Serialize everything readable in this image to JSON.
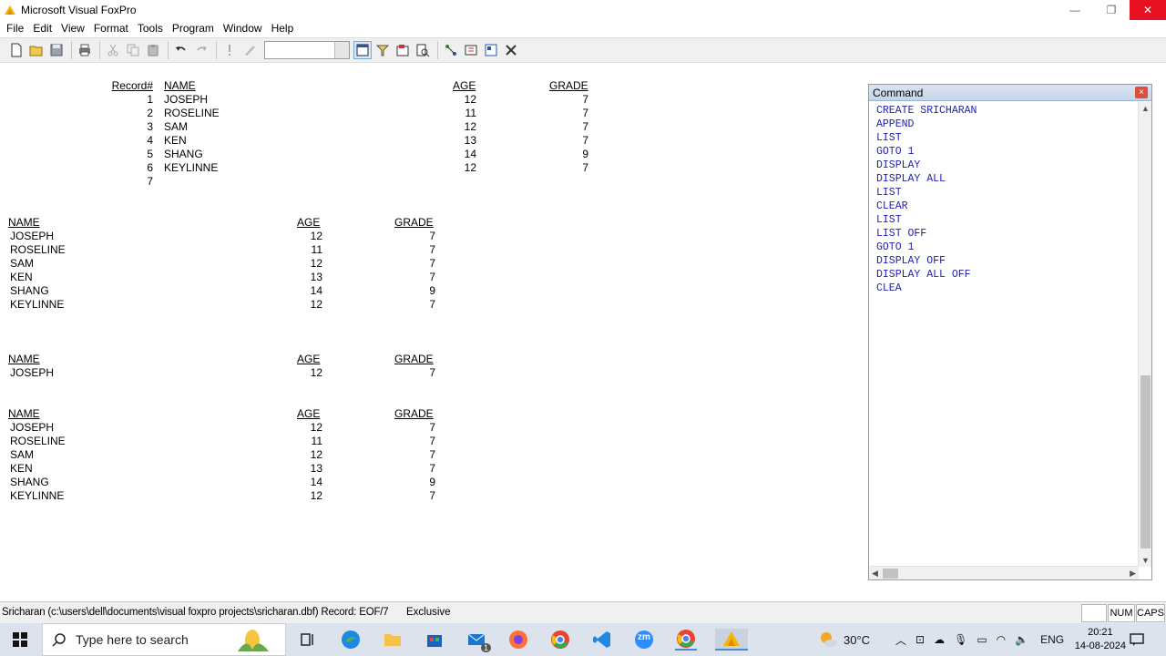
{
  "window": {
    "title": "Microsoft Visual FoxPro",
    "minimize_glyph": "—",
    "restore_glyph": "❐",
    "close_glyph": "✕"
  },
  "menu": [
    "File",
    "Edit",
    "View",
    "Format",
    "Tools",
    "Program",
    "Window",
    "Help"
  ],
  "output": {
    "list1": {
      "headers": {
        "record": "Record#",
        "name": "NAME",
        "age": "AGE",
        "grade": "GRADE"
      },
      "rows": [
        {
          "rec": "1",
          "name": "JOSEPH",
          "age": "12",
          "grade": "7"
        },
        {
          "rec": "2",
          "name": "ROSELINE",
          "age": "11",
          "grade": "7"
        },
        {
          "rec": "3",
          "name": "SAM",
          "age": "12",
          "grade": "7"
        },
        {
          "rec": "4",
          "name": "KEN",
          "age": "13",
          "grade": "7"
        },
        {
          "rec": "5",
          "name": "SHANG",
          "age": "14",
          "grade": "9"
        },
        {
          "rec": "6",
          "name": "KEYLINNE",
          "age": "12",
          "grade": "7"
        }
      ],
      "eof_record": "7"
    },
    "list2": {
      "headers": {
        "name": "NAME",
        "age": "AGE",
        "grade": "GRADE"
      },
      "rows": [
        {
          "name": "JOSEPH",
          "age": "12",
          "grade": "7"
        },
        {
          "name": "ROSELINE",
          "age": "11",
          "grade": "7"
        },
        {
          "name": "SAM",
          "age": "12",
          "grade": "7"
        },
        {
          "name": "KEN",
          "age": "13",
          "grade": "7"
        },
        {
          "name": "SHANG",
          "age": "14",
          "grade": "9"
        },
        {
          "name": "KEYLINNE",
          "age": "12",
          "grade": "7"
        }
      ]
    },
    "display1": {
      "headers": {
        "name": "NAME",
        "age": "AGE",
        "grade": "GRADE"
      },
      "rows": [
        {
          "name": "JOSEPH",
          "age": "12",
          "grade": "7"
        }
      ]
    },
    "list3": {
      "headers": {
        "name": "NAME",
        "age": "AGE",
        "grade": "GRADE"
      },
      "rows": [
        {
          "name": "JOSEPH",
          "age": "12",
          "grade": "7"
        },
        {
          "name": "ROSELINE",
          "age": "11",
          "grade": "7"
        },
        {
          "name": "SAM",
          "age": "12",
          "grade": "7"
        },
        {
          "name": "KEN",
          "age": "13",
          "grade": "7"
        },
        {
          "name": "SHANG",
          "age": "14",
          "grade": "9"
        },
        {
          "name": "KEYLINNE",
          "age": "12",
          "grade": "7"
        }
      ]
    }
  },
  "command_window": {
    "title": "Command",
    "close_glyph": "×",
    "lines": [
      "CREATE SRICHARAN",
      "APPEND",
      "LIST",
      "GOTO 1",
      "DISPLAY",
      "DISPLAY ALL",
      "LIST",
      "CLEAR",
      "LIST",
      "LIST OFF",
      "GOTO 1",
      "DISPLAY OFF",
      "DISPLAY ALL OFF",
      "CLEA"
    ]
  },
  "statusbar": {
    "path": "Sricharan (c:\\users\\dell\\documents\\visual foxpro projects\\sricharan.dbf) Record: EOF/7",
    "mode": "Exclusive",
    "num": "NUM",
    "caps": "CAPS"
  },
  "taskbar": {
    "search_placeholder": "Type here to search",
    "temperature": "30°C",
    "language": "ENG",
    "time": "20:21",
    "date": "14-08-2024",
    "mail_badge": "1",
    "zoom_label": "zm"
  },
  "colors": {
    "command_text": "#1f1fb0",
    "close_red": "#e81123",
    "taskbar_bg": "#dce3ec"
  }
}
